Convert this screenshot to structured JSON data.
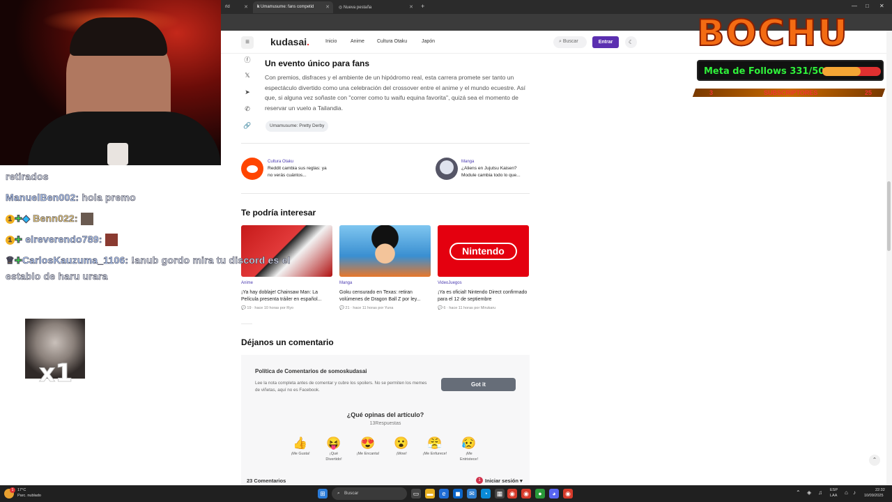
{
  "browser": {
    "tabs": [
      {
        "label": "rld"
      },
      {
        "label": "Umamusume: fans competid"
      },
      {
        "label": "Nueva pestaña"
      }
    ]
  },
  "site": {
    "logo": "kudasai",
    "logo_dot": ".",
    "nav": [
      "Inicio",
      "Anime",
      "Cultura Otaku",
      "Japón"
    ],
    "search_label": "Buscar",
    "login_label": "Entrar"
  },
  "article": {
    "heading": "Un evento único para fans",
    "paragraph": "Con premios, disfraces y el ambiente de un hipódromo real, esta carrera promete ser tanto un espectáculo divertido como una celebración del crossover entre el anime y el mundo ecuestre. Así que, si alguna vez soñaste con \"correr como tu waifu equina favorita\", quizá sea el momento de reservar un vuelo a Tailandia.",
    "tag": "Umamusume: Pretty Derby"
  },
  "related": [
    {
      "category": "Cultura Otaku",
      "title_1": "Reddit cambia sus reglas: ya",
      "title_2": "no verás cuántos..."
    },
    {
      "category": "Manga",
      "title_1": "¿Aliens en Jujutsu Kaisen?",
      "title_2": "Module cambia todo lo que..."
    }
  ],
  "interest": {
    "heading": "Te podría interesar",
    "cards": [
      {
        "category": "Anime",
        "title": "¡Ya hay doblaje! Chainsaw Man: La Película presenta tráiler en español...",
        "comments": "19",
        "time": "hace 10 horas por",
        "author": "Ryo"
      },
      {
        "category": "Manga",
        "title": "Goku censurado en Texas: retiran volúmenes de Dragon Ball Z por ley...",
        "comments": "21",
        "time": "hace 11 horas por",
        "author": "Yuna"
      },
      {
        "category": "VideoJuegos",
        "title": "¡Ya es oficial! Nintendo Direct confirmado para el 12 de septiembre",
        "comments": "6",
        "time": "hace 11 horas por",
        "author": "Mirukaru",
        "thumb_text": "Nintendo"
      }
    ]
  },
  "comments": {
    "heading": "Déjanos un comentario",
    "policy_title": "Política de Comentarios de somoskudasai",
    "policy_text": "Lee la nota completa antes de comentar y cubre los spoilers. No se permiten los memes de viñetas, aquí no es Facebook.",
    "got_it": "Got it",
    "question": "¿Qué opinas del artículo?",
    "responses": "13Respuestas",
    "reactions": [
      {
        "emoji": "👍",
        "label_1": "¡Me Gusta!",
        "label_2": ""
      },
      {
        "emoji": "😝",
        "label_1": "¡Qué",
        "label_2": "Divertido!"
      },
      {
        "emoji": "😍",
        "label_1": "¡Me Encanta!",
        "label_2": ""
      },
      {
        "emoji": "😮",
        "label_1": "¡Wow!",
        "label_2": ""
      },
      {
        "emoji": "😤",
        "label_1": "¡Me Enfurece!",
        "label_2": ""
      },
      {
        "emoji": "😥",
        "label_1": "¡Me",
        "label_2": "Entristece!"
      }
    ],
    "count": "23 Comentarios",
    "login": "Iniciar sesión",
    "notif": "1"
  },
  "stream": {
    "chat": [
      {
        "user": "",
        "text": "retirados"
      },
      {
        "user": "ManuelBen002:",
        "text": "hola premo"
      },
      {
        "user": "Benn022:",
        "text": ""
      },
      {
        "user": "elreverendo789:",
        "text": ""
      },
      {
        "user": "CarlosKauzuma_1106:",
        "text": "!anub gordo mira tu discord es el"
      },
      {
        "user": "",
        "text": "establo de haru urara"
      }
    ],
    "badge_1": "1",
    "combo": "x1",
    "logo": "BOCHU",
    "goal": "Meta de Follows 331/500",
    "goal_fraction": 0.66,
    "subs_left": "3",
    "subs_label": "SUBSCRIPTORES",
    "subs_right": "25"
  },
  "taskbar": {
    "weather_temp": "17°C",
    "weather_desc": "Parc. nublado",
    "weather_badge": "1",
    "search": "Buscar",
    "lang_1": "ESP",
    "lang_2": "LAA",
    "time": "22:32",
    "date": "10/09/2025"
  }
}
